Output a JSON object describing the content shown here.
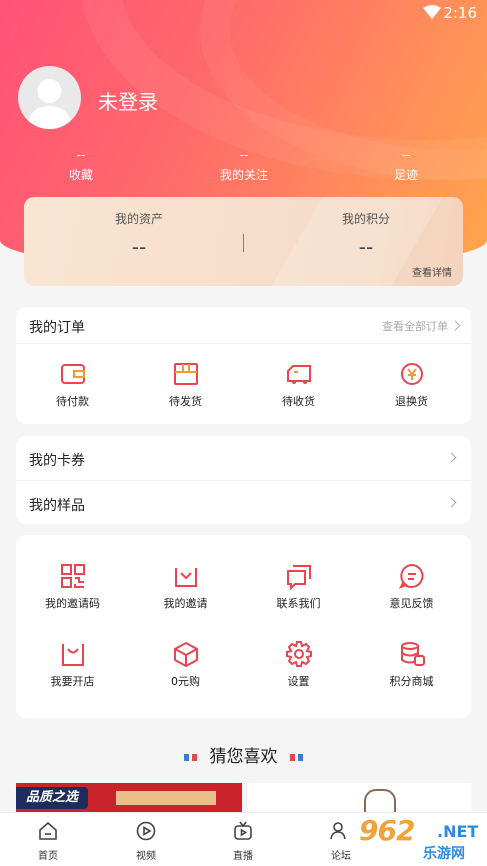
{
  "status_bar": {
    "time": "2:16"
  },
  "profile": {
    "username": "未登录"
  },
  "stats": [
    {
      "value": "--",
      "label": "收藏"
    },
    {
      "value": "--",
      "label": "我的关注"
    },
    {
      "value": "--",
      "label": "足迹"
    }
  ],
  "assets": {
    "left_title": "我的资产",
    "left_value": "--",
    "right_title": "我的积分",
    "right_value": "--",
    "more": "查看详情"
  },
  "orders": {
    "title": "我的订单",
    "view_all": "查看全部订单",
    "items": [
      {
        "label": "待付款",
        "icon": "wallet-icon"
      },
      {
        "label": "待发货",
        "icon": "package-icon"
      },
      {
        "label": "待收货",
        "icon": "truck-icon"
      },
      {
        "label": "退换货",
        "icon": "refund-icon"
      }
    ]
  },
  "list": [
    {
      "label": "我的卡券"
    },
    {
      "label": "我的样品"
    }
  ],
  "services": [
    {
      "label": "我的邀请码",
      "icon": "qrcode-icon"
    },
    {
      "label": "我的邀请",
      "icon": "invite-icon"
    },
    {
      "label": "联系我们",
      "icon": "chat-icon"
    },
    {
      "label": "意见反馈",
      "icon": "feedback-icon"
    },
    {
      "label": "我要开店",
      "icon": "shop-bag-icon"
    },
    {
      "label": "0元购",
      "icon": "box-icon"
    },
    {
      "label": "设置",
      "icon": "gear-icon"
    },
    {
      "label": "积分商城",
      "icon": "coins-icon"
    }
  ],
  "guess": {
    "title": "猜您喜欢"
  },
  "promo": {
    "tag": "品质之选"
  },
  "tabbar": [
    {
      "label": "首页",
      "icon": "home-icon"
    },
    {
      "label": "视频",
      "icon": "video-icon"
    },
    {
      "label": "直播",
      "icon": "live-icon"
    },
    {
      "label": "论坛",
      "icon": "forum-icon"
    }
  ],
  "watermark": {
    "brand": "962",
    "domain": ".NET",
    "name": "乐游网"
  },
  "colors": {
    "accent": "#e8454f",
    "hero_start": "#ff5277",
    "hero_end": "#ffa54a"
  }
}
